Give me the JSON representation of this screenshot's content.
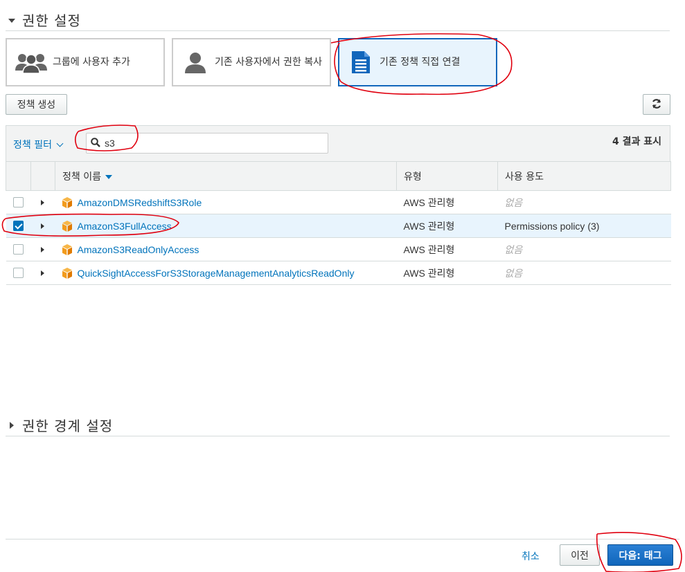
{
  "permissions_section": {
    "title": "권한 설정"
  },
  "options": [
    {
      "label": "그룹에 사용자 추가",
      "icon": "users-group-icon"
    },
    {
      "label": "기존 사용자에서 권한 복사",
      "icon": "user-icon"
    },
    {
      "label": "기존 정책 직접 연결",
      "icon": "document-icon",
      "selected": true
    }
  ],
  "toolbar": {
    "create_policy_label": "정책 생성",
    "refresh_icon": "refresh-icon"
  },
  "filter": {
    "label": "정책 필터",
    "search_value": "s3",
    "result_count": "4 결과 표시"
  },
  "table": {
    "columns": [
      "정책 이름",
      "유형",
      "사용 용도"
    ],
    "rows": [
      {
        "name": "AmazonDMSRedshiftS3Role",
        "type": "AWS 관리형",
        "usage": "없음",
        "checked": false
      },
      {
        "name": "AmazonS3FullAccess",
        "type": "AWS 관리형",
        "usage": "Permissions policy (3)",
        "checked": true
      },
      {
        "name": "AmazonS3ReadOnlyAccess",
        "type": "AWS 관리형",
        "usage": "없음",
        "checked": false
      },
      {
        "name": "QuickSightAccessForS3StorageManagementAnalyticsReadOnly",
        "type": "AWS 관리형",
        "usage": "없음",
        "checked": false
      }
    ]
  },
  "boundary_section": {
    "title": "권한 경계 설정"
  },
  "footer": {
    "cancel_label": "취소",
    "previous_label": "이전",
    "next_label": "다음: 태그"
  },
  "colors": {
    "accent": "#0073bb",
    "primary": "#1166bb",
    "annotation": "#e0000f",
    "cube": "#f29b1d"
  }
}
